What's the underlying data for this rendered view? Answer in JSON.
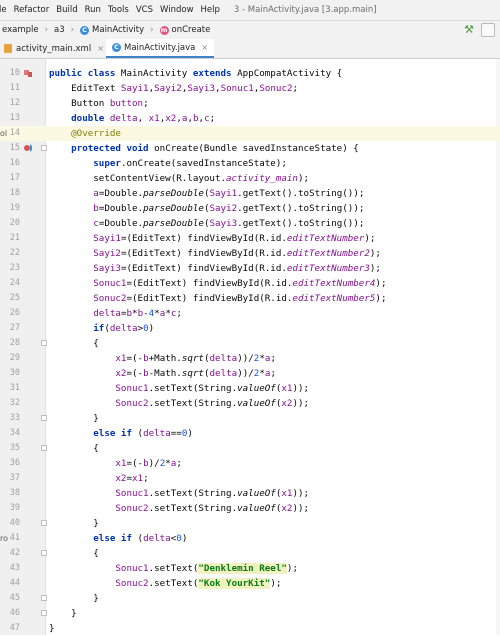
{
  "menubar": {
    "items": [
      "le",
      "Refactor",
      "Build",
      "Run",
      "Tools",
      "VCS",
      "Window",
      "Help"
    ],
    "window_title": "3 - MainActivity.java [3.app.main]"
  },
  "navbar": {
    "crumbs": [
      "example",
      "a3",
      "MainActivity",
      "onCreate"
    ],
    "class_badge": "C",
    "method_badge": "m"
  },
  "tabs": [
    {
      "label": "activity_main.xml",
      "close": "×"
    },
    {
      "label": "MainActivity.java",
      "close": "×"
    }
  ],
  "editor": {
    "line_numbers": [
      "10",
      "11",
      "12",
      "13",
      "14",
      "15",
      "16",
      "17",
      "18",
      "19",
      "20",
      "21",
      "22",
      "23",
      "24",
      "25",
      "26",
      "27",
      "28",
      "29",
      "30",
      "31",
      "32",
      "33",
      "34",
      "35",
      "36",
      "37",
      "38",
      "39",
      "40",
      "41",
      "42",
      "43",
      "44",
      "45",
      "46",
      "47"
    ],
    "left_edge_fragments": {
      "ol": "ol",
      "ro": "ro"
    }
  },
  "colors": {
    "keyword": "#0033b3",
    "string": "#067d17",
    "annotation": "#808000",
    "field": "#871094",
    "caret_line": "#fcf9e3",
    "active_tab_underline": "#4083c9"
  }
}
